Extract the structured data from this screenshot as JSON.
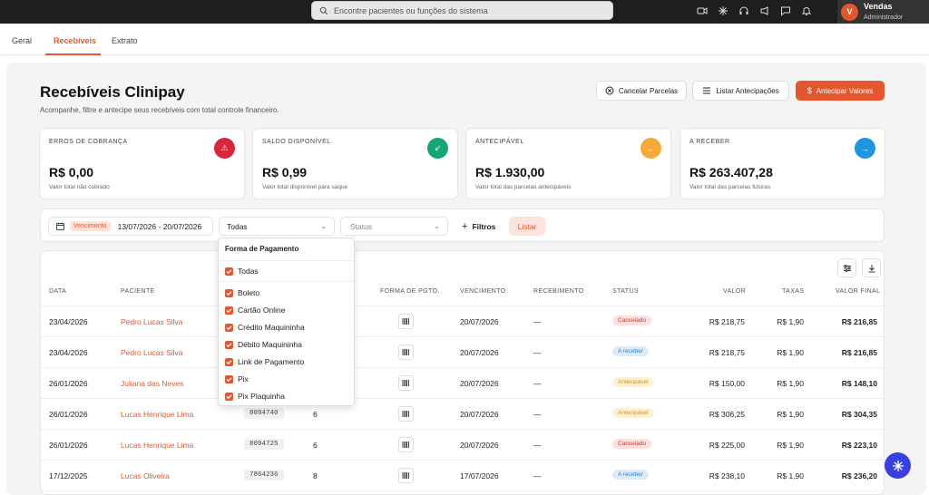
{
  "search": {
    "placeholder": "Encontre pacientes ou funções do sistema"
  },
  "user": {
    "initial": "V",
    "name": "Vendas",
    "role": "Administrador"
  },
  "tabs": [
    {
      "label": "Geral"
    },
    {
      "label": "Recebíveis"
    },
    {
      "label": "Extrato"
    }
  ],
  "page": {
    "title": "Recebíveis Clinipay",
    "subtitle": "Acompanhe, filtre e antecipe seus recebíveis com total controle financeiro."
  },
  "actions": {
    "cancel": "Cancelar Parcelas",
    "list": "Listar Antecipações",
    "anticipate": "Antecipar Valores"
  },
  "cards": [
    {
      "label": "ERROS DE COBRANÇA",
      "value": "R$ 0,00",
      "sub": "Valor total não cobrado",
      "color": "#d9263a",
      "icon": "warning-icon"
    },
    {
      "label": "SALDO DISPONÍVEL",
      "value": "R$ 0,99",
      "sub": "Valor total disponível para saque",
      "color": "#18a574",
      "icon": "arrow-down-left-icon"
    },
    {
      "label": "ANTECIPÁVEL",
      "value": "R$ 1.930,00",
      "sub": "Valor total das parcelas antecipáveis",
      "color": "#f5a93b",
      "icon": "arrow-left-icon"
    },
    {
      "label": "A RECEBER",
      "value": "R$ 263.407,28",
      "sub": "Valor total das parcelas futuras",
      "color": "#1e95dd",
      "icon": "arrow-right-icon"
    }
  ],
  "filters": {
    "date_chip": "Vencimento",
    "date_range": "13/07/2026 - 20/07/2026",
    "payment": "Todas",
    "status_placeholder": "Status",
    "more": "Filtros",
    "list": "Listar"
  },
  "dropdown": {
    "title": "Forma de Pagamento",
    "all": "Todas",
    "options": [
      "Boleto",
      "Cartão Online",
      "Crédito Maquininha",
      "Débito Maquininha",
      "Link de Pagamento",
      "Pix",
      "Pix Plaquinha"
    ]
  },
  "table": {
    "headers": [
      "DATA",
      "PACIENTE",
      "FORMA DE PGTO.",
      "VENCIMENTO",
      "RECEBIMENTO",
      "STATUS",
      "VALOR",
      "TAXAS",
      "VALOR FINAL"
    ],
    "rows": [
      {
        "date": "23/04/2026",
        "patient": "Pedro Lucas Silva",
        "code": "",
        "inst": "",
        "due": "20/07/2026",
        "received": "—",
        "status": "Cancelado",
        "kind": "c",
        "value": "R$ 218,75",
        "fee": "R$ 1,90",
        "final": "R$ 216,85"
      },
      {
        "date": "23/04/2026",
        "patient": "Pedro Lucas Silva",
        "code": "",
        "inst": "",
        "due": "20/07/2026",
        "received": "—",
        "status": "A receber",
        "kind": "r",
        "value": "R$ 218,75",
        "fee": "R$ 1,90",
        "final": "R$ 216,85"
      },
      {
        "date": "26/01/2026",
        "patient": "Juliana das Neves",
        "code": "",
        "inst": "",
        "due": "20/07/2026",
        "received": "—",
        "status": "Antecipável",
        "kind": "a",
        "value": "R$ 150,00",
        "fee": "R$ 1,90",
        "final": "R$ 148,10"
      },
      {
        "date": "26/01/2026",
        "patient": "Lucas Henrique Lima",
        "code": "8094740",
        "inst": "6",
        "due": "20/07/2026",
        "received": "—",
        "status": "Antecipável",
        "kind": "a",
        "value": "R$ 306,25",
        "fee": "R$ 1,90",
        "final": "R$ 304,35"
      },
      {
        "date": "26/01/2026",
        "patient": "Lucas Henrique Lima",
        "code": "8094725",
        "inst": "6",
        "due": "20/07/2026",
        "received": "—",
        "status": "Cancelado",
        "kind": "c",
        "value": "R$ 225,00",
        "fee": "R$ 1,90",
        "final": "R$ 223,10"
      },
      {
        "date": "17/12/2025",
        "patient": "Lucas Oliveira",
        "code": "7864236",
        "inst": "8",
        "due": "17/07/2026",
        "received": "—",
        "status": "A receber",
        "kind": "r",
        "value": "R$ 238,10",
        "fee": "R$ 1,90",
        "final": "R$ 236,20"
      }
    ]
  }
}
